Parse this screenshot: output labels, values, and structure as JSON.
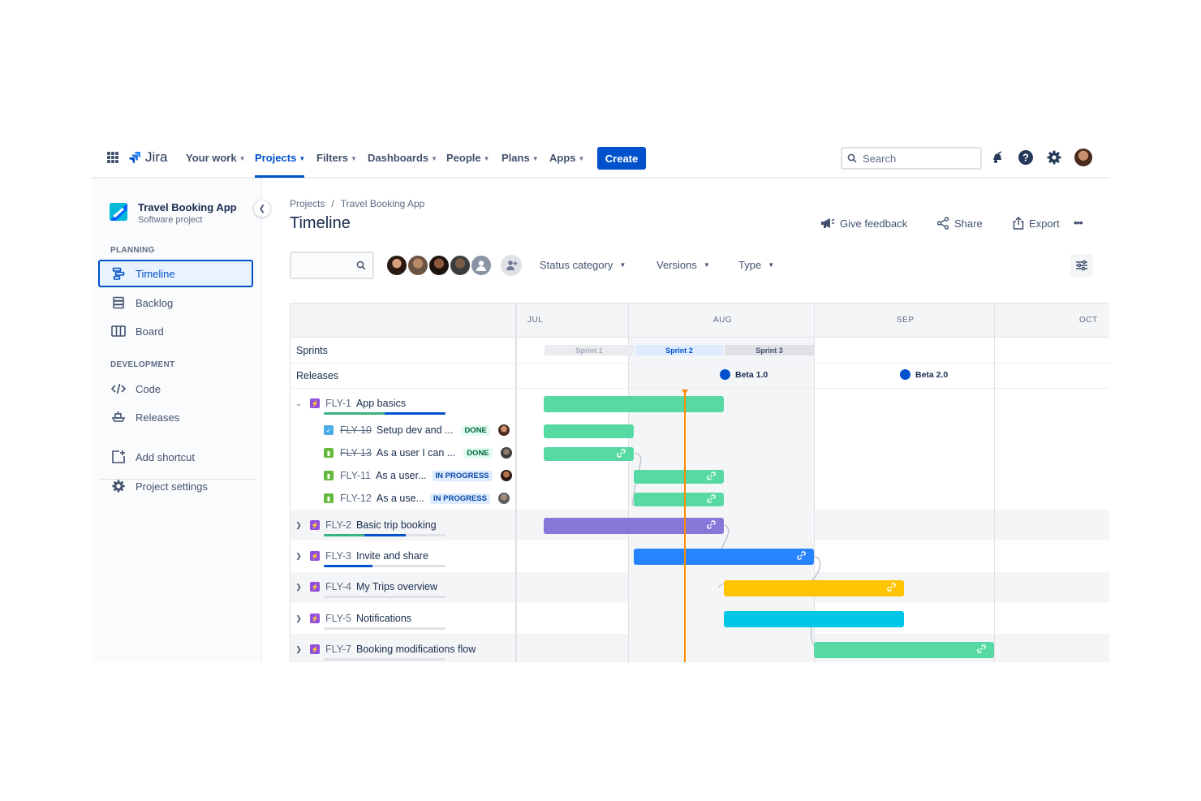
{
  "nav": {
    "logo": "Jira",
    "items": [
      {
        "label": "Your work"
      },
      {
        "label": "Projects"
      },
      {
        "label": "Filters"
      },
      {
        "label": "Dashboards"
      },
      {
        "label": "People"
      },
      {
        "label": "Plans"
      },
      {
        "label": "Apps"
      }
    ],
    "create": "Create",
    "search_placeholder": "Search"
  },
  "sidebar": {
    "project_name": "Travel Booking App",
    "project_type": "Software project",
    "planning_label": "PLANNING",
    "planning": [
      {
        "label": "Timeline",
        "icon": "timeline-icon",
        "active": true
      },
      {
        "label": "Backlog",
        "icon": "backlog-icon"
      },
      {
        "label": "Board",
        "icon": "board-icon"
      }
    ],
    "development_label": "DEVELOPMENT",
    "development": [
      {
        "label": "Code",
        "icon": "code-icon"
      },
      {
        "label": "Releases",
        "icon": "releases-icon"
      }
    ],
    "add_shortcut": "Add shortcut",
    "project_settings": "Project settings"
  },
  "main": {
    "breadcrumb": [
      "Projects",
      "/",
      "Travel Booking App"
    ],
    "title": "Timeline",
    "actions": {
      "feedback": "Give feedback",
      "share": "Share",
      "export": "Export",
      "more": "•••"
    },
    "filters": {
      "status": "Status category",
      "versions": "Versions",
      "type": "Type"
    }
  },
  "timeline": {
    "months": [
      "JUL",
      "AUG",
      "SEP",
      "OCT"
    ],
    "sprints_label": "Sprints",
    "sprints": [
      {
        "name": "Sprint 1",
        "state": "closed"
      },
      {
        "name": "Sprint 2",
        "state": "active"
      },
      {
        "name": "Sprint 3",
        "state": "future"
      }
    ],
    "releases_label": "Releases",
    "releases": [
      "Beta 1.0",
      "Beta 2.0"
    ],
    "epics": [
      {
        "key": "FLY-1",
        "title": "App basics",
        "expanded": true,
        "color": "#57d9a3"
      },
      {
        "key": "FLY-2",
        "title": "Basic trip booking",
        "expanded": false,
        "color": "#8777d9"
      },
      {
        "key": "FLY-3",
        "title": "Invite and share",
        "expanded": false,
        "color": "#2684ff"
      },
      {
        "key": "FLY-4",
        "title": "My Trips overview",
        "expanded": false,
        "color": "#ffc400"
      },
      {
        "key": "FLY-5",
        "title": "Notifications",
        "expanded": false,
        "color": "#00c7e6"
      },
      {
        "key": "FLY-7",
        "title": "Booking modifications flow",
        "expanded": false,
        "color": "#57d9a3"
      }
    ],
    "children": [
      {
        "key": "FLY-10",
        "title": "Setup dev and ...",
        "status": "DONE",
        "type": "task"
      },
      {
        "key": "FLY-13",
        "title": "As a user I can ...",
        "status": "DONE",
        "type": "story"
      },
      {
        "key": "FLY-11",
        "title": "As a user...",
        "status": "IN PROGRESS",
        "type": "story"
      },
      {
        "key": "FLY-12",
        "title": "As a use...",
        "status": "IN PROGRESS",
        "type": "story"
      }
    ]
  }
}
